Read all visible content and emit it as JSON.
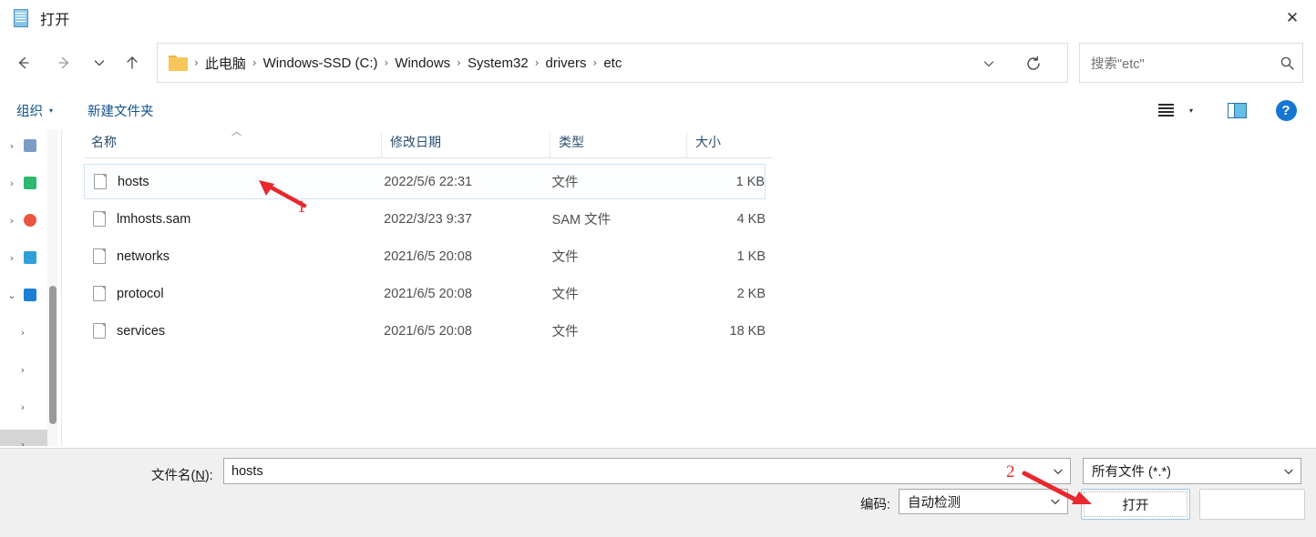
{
  "window": {
    "title": "打开",
    "icon": "notepad-icon",
    "close_label": "✕"
  },
  "nav": {
    "back_title": "后退",
    "forward_title": "前进",
    "recent_title": "最近使用的位置",
    "up_title": "向上"
  },
  "address": {
    "crumbs": [
      "此电脑",
      "Windows-SSD (C:)",
      "Windows",
      "System32",
      "drivers",
      "etc"
    ],
    "separator": "›",
    "dropdown": "chevron-down-icon",
    "refresh": "refresh-icon"
  },
  "search": {
    "placeholder": "搜索\"etc\"",
    "icon": "search-icon"
  },
  "toolbar": {
    "organize_label": "组织",
    "organize_caret": "▾",
    "new_folder_label": "新建文件夹",
    "view_caret": "▾",
    "view_icon": "view-options-icon",
    "preview_icon": "preview-pane-icon",
    "help_label": "?"
  },
  "navpane": {
    "expander_collapsed": "›",
    "expander_expanded": "⌄",
    "items": [
      {
        "state": "collapsed",
        "level": 1,
        "icon_color": "#7a9cc6",
        "selected": false
      },
      {
        "state": "collapsed",
        "level": 1,
        "icon_color": "#2eb872",
        "selected": false
      },
      {
        "state": "collapsed",
        "level": 1,
        "icon_color": "#e8563f",
        "selected": false
      },
      {
        "state": "collapsed",
        "level": 1,
        "icon_color": "#2f9fd8",
        "selected": false
      },
      {
        "state": "expanded",
        "level": 1,
        "icon_color": "#1c7fd4",
        "selected": false
      },
      {
        "state": "collapsed",
        "level": 2,
        "icon_color": "",
        "selected": false
      },
      {
        "state": "collapsed",
        "level": 2,
        "icon_color": "",
        "selected": false
      },
      {
        "state": "collapsed",
        "level": 2,
        "icon_color": "",
        "selected": false
      },
      {
        "state": "collapsed",
        "level": 2,
        "icon_color": "",
        "selected": true
      },
      {
        "state": "collapsed",
        "level": 2,
        "icon_color": "",
        "selected": false
      },
      {
        "state": "collapsed",
        "level": 1,
        "icon_color": "#5a5a5a",
        "selected": false
      }
    ]
  },
  "filelist": {
    "columns": [
      {
        "label": "名称",
        "sorted": true,
        "sort_caret": "︿"
      },
      {
        "label": "修改日期",
        "sorted": false,
        "sort_caret": ""
      },
      {
        "label": "类型",
        "sorted": false,
        "sort_caret": ""
      },
      {
        "label": "大小",
        "sorted": false,
        "sort_caret": ""
      }
    ],
    "rows": [
      {
        "name": "hosts",
        "date": "2022/5/6 22:31",
        "type": "文件",
        "size": "1 KB",
        "selected": true
      },
      {
        "name": "lmhosts.sam",
        "date": "2022/3/23 9:37",
        "type": "SAM 文件",
        "size": "4 KB",
        "selected": false
      },
      {
        "name": "networks",
        "date": "2021/6/5 20:08",
        "type": "文件",
        "size": "1 KB",
        "selected": false
      },
      {
        "name": "protocol",
        "date": "2021/6/5 20:08",
        "type": "文件",
        "size": "2 KB",
        "selected": false
      },
      {
        "name": "services",
        "date": "2021/6/5 20:08",
        "type": "文件",
        "size": "18 KB",
        "selected": false
      }
    ]
  },
  "footer": {
    "filename_label_pre": "文件名(",
    "filename_label_key": "N",
    "filename_label_post": "):",
    "filename_value": "hosts",
    "filetype_value": "所有文件 (*.*)",
    "encoding_label": "编码:",
    "encoding_value": "自动检测",
    "open_button": "打开",
    "cancel_button": "",
    "dropdown_caret": "⌄"
  },
  "annotations": [
    {
      "number": "1",
      "color": "#e8282c",
      "points_to": "hosts-row"
    },
    {
      "number": "2",
      "color": "#e8282c",
      "points_to": "open-button"
    }
  ]
}
